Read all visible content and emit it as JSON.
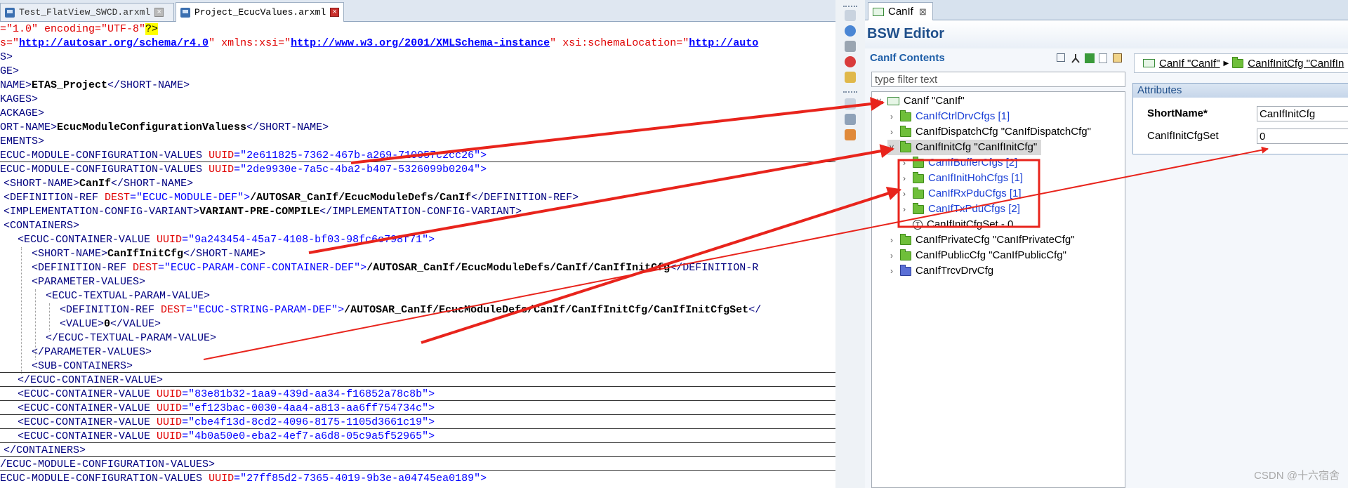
{
  "editor_tabs": [
    {
      "label": "Test_FlatView_SWCD.arxml",
      "active": false
    },
    {
      "label": "Project_EcucValues.arxml",
      "active": true
    }
  ],
  "xml": {
    "l1": {
      "a": "=\"1.0\" ",
      "b": "encoding",
      "c": "=\"UTF-8\"",
      "d": "?>"
    },
    "l2": {
      "a": "s=\"",
      "b": "http://autosar.org/schema/r4.0",
      "c": "\" ",
      "d": "xmlns:xsi",
      "e": "=\"",
      "f": "http://www.w3.org/2001/XMLSchema-instance",
      "g": "\" ",
      "h": "xsi:schemaLocation",
      "i": "=\"",
      "j": "http://auto"
    },
    "l3": "S>",
    "l4": "GE>",
    "l5": {
      "a": "NAME>",
      "b": "ETAS_Project",
      "c": "</SHORT-NAME>"
    },
    "l6": "KAGES>",
    "l7": "ACKAGE>",
    "l8": {
      "a": "ORT-NAME>",
      "b": "EcucModuleConfigurationValuess",
      "c": "</SHORT-NAME>"
    },
    "l9": "EMENTS>",
    "l10": {
      "a": "ECUC-MODULE-CONFIGURATION-VALUES ",
      "b": "UUID",
      "c": "=\"2e611825-7362-467b-a269-710057c2cc26\">"
    },
    "l11": {
      "a": "ECUC-MODULE-CONFIGURATION-VALUES ",
      "b": "UUID",
      "c": "=\"2de9930e-7a5c-4ba2-b407-5326099b0204\">"
    },
    "l12": {
      "a": "<SHORT-NAME>",
      "b": "CanIf",
      "c": "</SHORT-NAME>"
    },
    "l13": {
      "a": "<DEFINITION-REF ",
      "b": "DEST",
      "c": "=\"ECUC-MODULE-DEF\">",
      "d": "/AUTOSAR_CanIf/EcucModuleDefs/CanIf",
      "e": "</DEFINITION-REF>"
    },
    "l14": {
      "a": "<IMPLEMENTATION-CONFIG-VARIANT>",
      "b": "VARIANT-PRE-COMPILE",
      "c": "</IMPLEMENTATION-CONFIG-VARIANT>"
    },
    "l15": "<CONTAINERS>",
    "l16": {
      "a": "<ECUC-CONTAINER-VALUE ",
      "b": "UUID",
      "c": "=\"9a243454-45a7-4108-bf03-98fc6c798f71\">"
    },
    "l17": {
      "a": "<SHORT-NAME>",
      "b": "CanIfInitCfg",
      "c": "</SHORT-NAME>"
    },
    "l18": {
      "a": "<DEFINITION-REF ",
      "b": "DEST",
      "c": "=\"ECUC-PARAM-CONF-CONTAINER-DEF\">",
      "d": "/AUTOSAR_CanIf/EcucModuleDefs/CanIf/CanIfInitCfg",
      "e": "</DEFINITION-R"
    },
    "l19": "<PARAMETER-VALUES>",
    "l20": "<ECUC-TEXTUAL-PARAM-VALUE>",
    "l21": {
      "a": "<DEFINITION-REF ",
      "b": "DEST",
      "c": "=\"ECUC-STRING-PARAM-DEF\">",
      "d": "/AUTOSAR_CanIf/EcucModuleDefs/CanIf/CanIfInitCfg/CanIfInitCfgSet",
      "e": "</"
    },
    "l22": {
      "a": "<VALUE>",
      "b": "0",
      "c": "</VALUE>"
    },
    "l23": "</ECUC-TEXTUAL-PARAM-VALUE>",
    "l24": "</PARAMETER-VALUES>",
    "l25": "<SUB-CONTAINERS>",
    "l26": "</ECUC-CONTAINER-VALUE>",
    "l27": {
      "a": "<ECUC-CONTAINER-VALUE ",
      "b": "UUID",
      "c": "=\"83e81b32-1aa9-439d-aa34-f16852a78c8b\">"
    },
    "l28": {
      "a": "<ECUC-CONTAINER-VALUE ",
      "b": "UUID",
      "c": "=\"ef123bac-0030-4aa4-a813-aa6ff754734c\">"
    },
    "l29": {
      "a": "<ECUC-CONTAINER-VALUE ",
      "b": "UUID",
      "c": "=\"cbe4f13d-8cd2-4096-8175-1105d3661c19\">"
    },
    "l30": {
      "a": "<ECUC-CONTAINER-VALUE ",
      "b": "UUID",
      "c": "=\"4b0a50e0-eba2-4ef7-a6d8-05c9a5f52965\">"
    },
    "l31": "</CONTAINERS>",
    "l32": "/ECUC-MODULE-CONFIGURATION-VALUES>",
    "l33": {
      "a": "ECUC-MODULE-CONFIGURATION-VALUES ",
      "b": "UUID",
      "c": "=\"27ff85d2-7365-4019-9b3e-a04745ea0189\">"
    }
  },
  "view": {
    "tab_label": "CanIf",
    "tab_close": "⊠",
    "editor_title": "BSW Editor",
    "contents_title": "CanIf Contents",
    "filter_placeholder": "type filter text",
    "tree": [
      {
        "label": "CanIf \"CanIf\"",
        "chev": "˅"
      },
      {
        "label": "CanIfCtrlDrvCfgs [1]",
        "chev": "›"
      },
      {
        "label": "CanIfDispatchCfg \"CanIfDispatchCfg\"",
        "chev": "›"
      },
      {
        "label": "CanIfInitCfg \"CanIfInitCfg\"",
        "chev": "˅"
      },
      {
        "label": "CanIfBufferCfgs [2]",
        "chev": "›"
      },
      {
        "label": "CanIfInitHohCfgs [1]",
        "chev": "›"
      },
      {
        "label": "CanIfRxPduCfgs [1]",
        "chev": "›"
      },
      {
        "label": "CanIfTxPduCfgs [2]",
        "chev": "›"
      },
      {
        "label": "CanIfInitCfgSet - 0"
      },
      {
        "label": "CanIfPrivateCfg \"CanIfPrivateCfg\"",
        "chev": "›"
      },
      {
        "label": "CanIfPublicCfg \"CanIfPublicCfg\"",
        "chev": "›"
      },
      {
        "label": "CanIfTrcvDrvCfg",
        "chev": "›"
      }
    ],
    "breadcrumb": [
      "CanIf \"CanIf\"",
      "CanIfInitCfg \"CanIfIn"
    ],
    "attributes": {
      "header": "Attributes",
      "shortname_label": "ShortName*",
      "shortname_value": "CanIfInitCfg",
      "initcfgset_label": "CanIfInitCfgSet",
      "initcfgset_value": "0"
    }
  },
  "watermark": "CSDN @十六宿舍",
  "colors": {
    "annotation_red": "#e8241c",
    "title_blue": "#1f4f8b",
    "tree_link_blue": "#1a3fd6"
  }
}
